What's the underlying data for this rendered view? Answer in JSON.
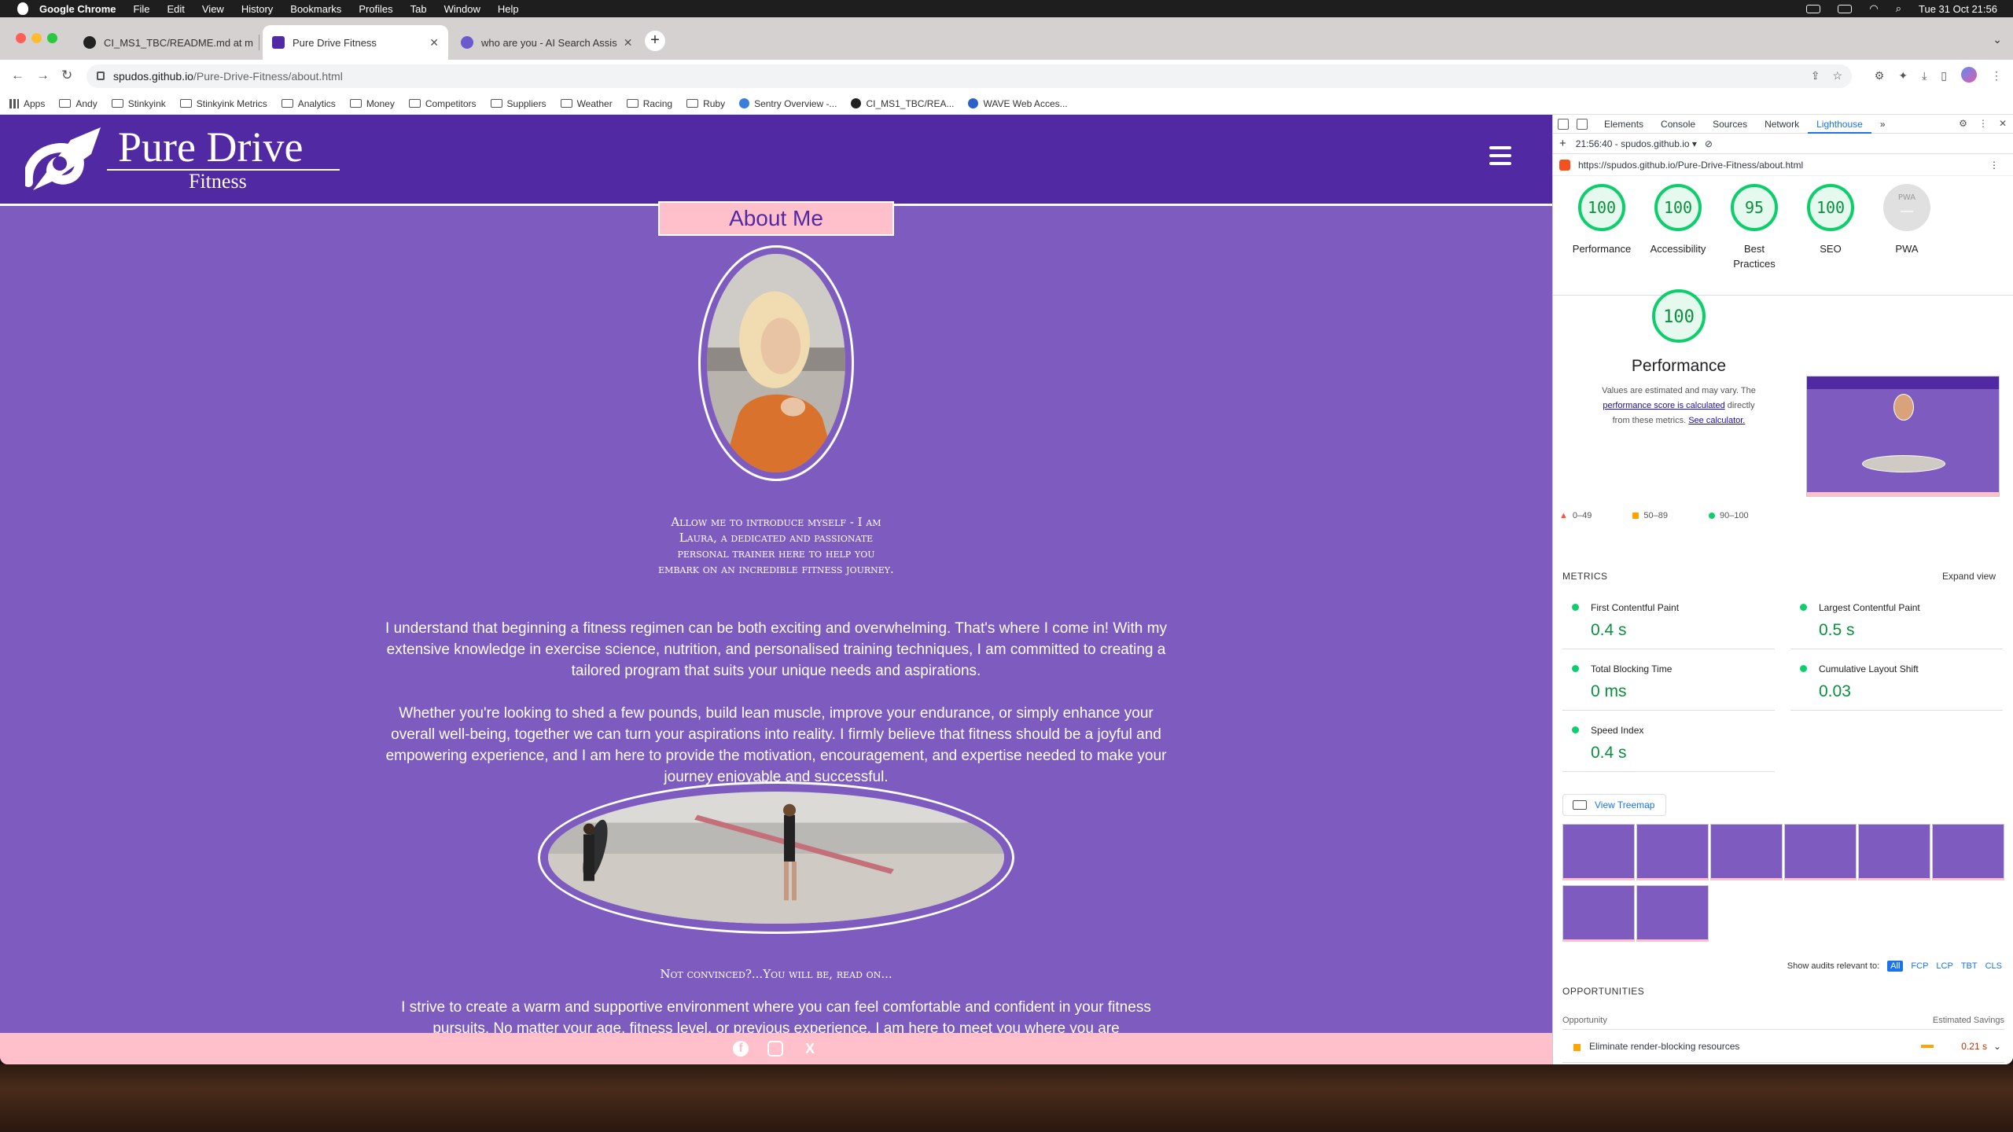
{
  "mac_menubar": {
    "items": [
      "Google Chrome",
      "File",
      "Edit",
      "View",
      "History",
      "Bookmarks",
      "Profiles",
      "Tab",
      "Window",
      "Help"
    ],
    "clock": "Tue 31 Oct  21:56"
  },
  "tabs": [
    {
      "title": "CI_MS1_TBC/README.md at m",
      "favicon_color": "#222222",
      "close": "✕"
    },
    {
      "title": "Pure Drive Fitness",
      "favicon_color": "#5129a3",
      "close": "✕"
    },
    {
      "title": "who are you - AI Search Assis",
      "favicon_color": "#6a5acd",
      "close": "✕"
    }
  ],
  "address": {
    "host": "spudos.github.io",
    "path": "/Pure-Drive-Fitness/about.html"
  },
  "bookmarks": [
    {
      "label": "Apps",
      "kind": "grid"
    },
    {
      "label": "Andy",
      "kind": "folder"
    },
    {
      "label": "Stinkyink",
      "kind": "folder"
    },
    {
      "label": "Stinkyink Metrics",
      "kind": "folder"
    },
    {
      "label": "Analytics",
      "kind": "folder"
    },
    {
      "label": "Money",
      "kind": "folder"
    },
    {
      "label": "Competitors",
      "kind": "folder"
    },
    {
      "label": "Suppliers",
      "kind": "folder"
    },
    {
      "label": "Weather",
      "kind": "folder"
    },
    {
      "label": "Racing",
      "kind": "folder"
    },
    {
      "label": "Ruby",
      "kind": "folder"
    },
    {
      "label": "Sentry Overview -...",
      "kind": "sentry"
    },
    {
      "label": "CI_MS1_TBC/REA...",
      "kind": "github"
    },
    {
      "label": "WAVE Web Acces...",
      "kind": "wave"
    }
  ],
  "site": {
    "brand_title": "Pure Drive",
    "brand_sub": "Fitness",
    "page_heading": "About Me",
    "intro": "Allow me to introduce myself - I am Laura, a dedicated and passionate personal trainer here to help you embark on an incredible fitness journey.",
    "para1": "I understand that beginning a fitness regimen can be both exciting and overwhelming. That's where I come in! With my extensive knowledge in exercise science, nutrition, and personalised training techniques, I am committed to creating a tailored program that suits your unique needs and aspirations.",
    "para2": "Whether you're looking to shed a few pounds, build lean muscle, improve your endurance, or simply enhance your overall well-being, together we can turn your aspirations into reality. I firmly believe that fitness should be a joyful and empowering experience, and I am here to provide the motivation, encouragement, and expertise needed to make your journey enjoyable and successful.",
    "not_convinced": "Not convinced?...You will be, read on...",
    "para3": "I strive to create a warm and supportive environment where you can feel comfortable and confident in your fitness pursuits. No matter your age, fitness level, or previous experience, I am here to meet you where you are",
    "colors": {
      "header": "#5129a3",
      "body": "#7e5bbf",
      "pink": "#ffc0cc"
    }
  },
  "devtools": {
    "tabs": [
      "Elements",
      "Console",
      "Sources",
      "Network",
      "Lighthouse"
    ],
    "active_tab": "Lighthouse",
    "report_time": "21:56:40 - spudos.github.io ▾",
    "report_url": "https://spudos.github.io/Pure-Drive-Fitness/about.html",
    "scores": [
      {
        "label": "Performance",
        "value": 100
      },
      {
        "label": "Accessibility",
        "value": 100
      },
      {
        "label": "Best Practices",
        "value": 95
      },
      {
        "label": "SEO",
        "value": 100
      },
      {
        "label": "PWA",
        "value": "—",
        "badge": "PWA"
      }
    ],
    "perf": {
      "score": 100,
      "title": "Performance",
      "desc1": "Values are estimated and may vary. The ",
      "link1": "performance score is calculated",
      "desc2": " directly from these metrics. ",
      "link2": "See calculator."
    },
    "legend": [
      {
        "range": "0–49",
        "color": "#ff4e42"
      },
      {
        "range": "50–89",
        "color": "#ffa400"
      },
      {
        "range": "90–100",
        "color": "#0cce6b"
      }
    ],
    "metrics_title": "METRICS",
    "expand_view": "Expand view",
    "metrics": [
      {
        "name": "First Contentful Paint",
        "value": "0.4 s"
      },
      {
        "name": "Largest Contentful Paint",
        "value": "0.5 s"
      },
      {
        "name": "Total Blocking Time",
        "value": "0 ms"
      },
      {
        "name": "Cumulative Layout Shift",
        "value": "0.03"
      },
      {
        "name": "Speed Index",
        "value": "0.4 s"
      }
    ],
    "view_treemap": "View Treemap",
    "show_audits_label": "Show audits relevant to:",
    "audit_filters": [
      "All",
      "FCP",
      "LCP",
      "TBT",
      "CLS"
    ],
    "opportunities_title": "OPPORTUNITIES",
    "opportunity_col": "Opportunity",
    "savings_col": "Estimated Savings",
    "opportunity_items": [
      {
        "name": "Eliminate render-blocking resources",
        "savings": "0.21 s"
      }
    ]
  }
}
